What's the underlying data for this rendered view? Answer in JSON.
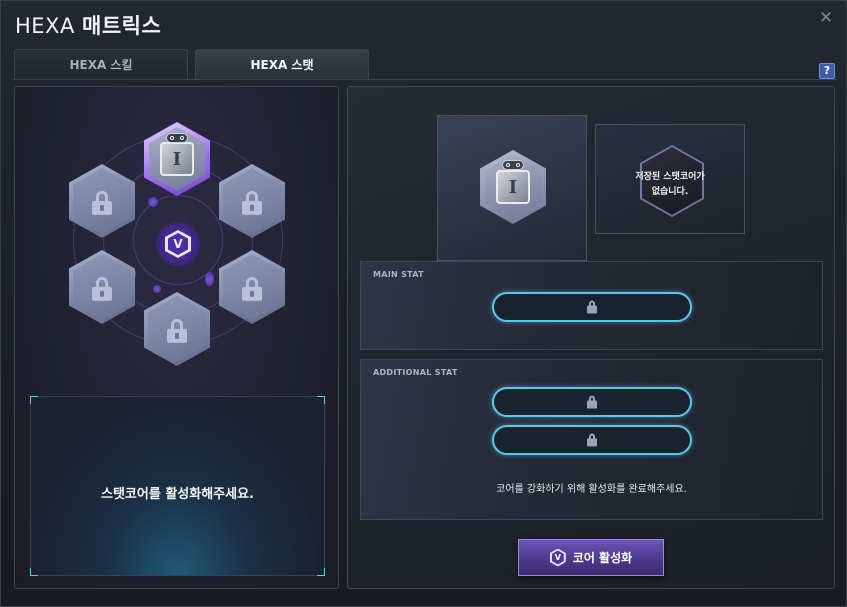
{
  "window": {
    "title_prefix": "HEXA",
    "title_main": "매트릭스",
    "close_icon": "close-icon",
    "help_label": "?"
  },
  "tabs": [
    {
      "label": "HEXA 스킬",
      "active": false
    },
    {
      "label": "HEXA 스탯",
      "active": true
    }
  ],
  "left": {
    "activated_core": {
      "glyph": "I"
    },
    "locked_slots": 5,
    "emblem_glyph": "V",
    "message": "스탯코어를 활성화해주세요."
  },
  "right": {
    "current_core_glyph": "I",
    "saved_core_text": "저장된 스탯코어가\n없습니다.",
    "main_stat": {
      "title": "MAIN STAT"
    },
    "additional_stat": {
      "title": "ADDITIONAL STAT",
      "notice": "코어를 강화하기 위해 활성화를 완료해주세요."
    },
    "activate_button": {
      "label": "코어 활성화",
      "glyph": "V"
    }
  },
  "colors": {
    "accent_cyan": "#59c9ea",
    "accent_purple": "#6c55b8",
    "help_blue": "#3c5ea8"
  }
}
